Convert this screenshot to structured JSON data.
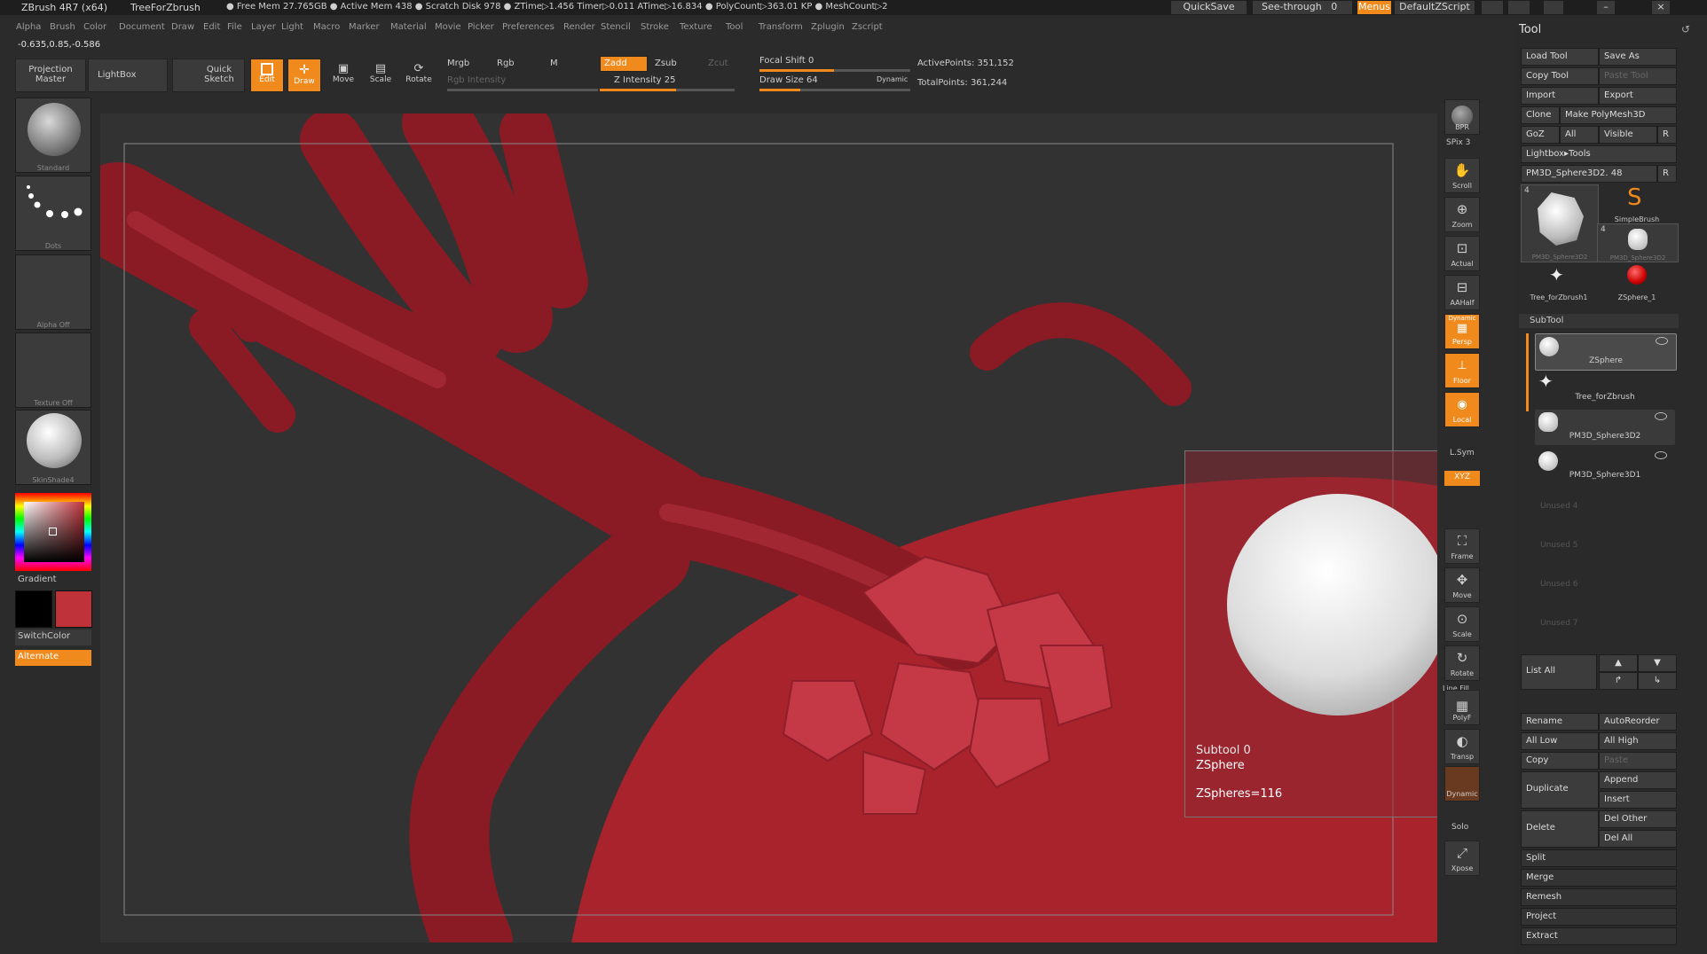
{
  "titlebar": {
    "app": "ZBrush 4R7 (x64)",
    "doc": "TreeForZbrush",
    "stats": "● Free Mem 27.765GB ● Active Mem 438 ● Scratch Disk 978 ● ZTime▷1.456 Timer▷0.011 ATime▷16.834 ● PolyCount▷363.01 KP ● MeshCount▷2",
    "quicksave": "QuickSave",
    "seethrough": "See-through",
    "seethrough_value": "0",
    "menus": "Menus",
    "defaultzscript": "DefaultZScript"
  },
  "menubar": [
    "Alpha",
    "Brush",
    "Color",
    "Document",
    "Draw",
    "Edit",
    "File",
    "Layer",
    "Light",
    "Macro",
    "Marker",
    "Material",
    "Movie",
    "Picker",
    "Preferences",
    "Render",
    "Stencil",
    "Stroke",
    "Texture",
    "Tool",
    "Transform",
    "Zplugin",
    "Zscript"
  ],
  "coords": "-0.635,0.85,-0.586",
  "toolbar": {
    "projection_master": "Projection Master",
    "lightbox": "LightBox",
    "quick_sketch": "Quick Sketch",
    "edit": "Edit",
    "draw": "Draw",
    "move": "Move",
    "scale": "Scale",
    "rotate": "Rotate",
    "mrgb": "Mrgb",
    "rgb": "Rgb",
    "m": "M",
    "rgb_intensity": "Rgb Intensity",
    "zadd": "Zadd",
    "zsub": "Zsub",
    "zcut": "Zcut",
    "z_intensity": "Z Intensity 25",
    "focal_shift": "Focal Shift 0",
    "draw_size": "Draw Size 64",
    "dynamic": "Dynamic",
    "active_points": "ActivePoints: 351,152",
    "total_points": "TotalPoints: 361,244"
  },
  "left_shelf": {
    "standard": "Standard",
    "dots": "Dots",
    "alpha_off": "Alpha Off",
    "texture_off": "Texture Off",
    "skinshade": "SkinShade4",
    "gradient": "Gradient",
    "switchcolor": "SwitchColor",
    "alternate": "Alternate",
    "main_color": "#c0323a",
    "secondary_color": "#000000"
  },
  "viewport": {
    "popup_subtool": "Subtool 0",
    "popup_name": "ZSphere",
    "popup_count": "ZSpheres=116"
  },
  "vtoolbar": {
    "bpr": "BPR",
    "spix": "SPix 3",
    "scroll": "Scroll",
    "zoom": "Zoom",
    "actual": "Actual",
    "aahalf": "AAHalf",
    "dynamic": "Dynamic",
    "persp": "Persp",
    "floor": "Floor",
    "local": "Local",
    "lsym": "L.Sym",
    "xyz": "XYZ",
    "frame": "Frame",
    "move": "Move",
    "scale": "Scale",
    "rotate": "Rotate",
    "line_fill": "Line Fill",
    "polyf": "PolyF",
    "transp": "Transp",
    "dynamic2": "Dynamic",
    "solo": "Solo",
    "xpose": "Xpose"
  },
  "panel": {
    "title": "Tool",
    "load_tool": "Load Tool",
    "save_as": "Save As",
    "copy_tool": "Copy Tool",
    "paste_tool": "Paste Tool",
    "import": "Import",
    "export": "Export",
    "clone": "Clone",
    "make_polymesh": "Make PolyMesh3D",
    "goz": "GoZ",
    "all": "All",
    "visible": "Visible",
    "r": "R",
    "lightbox_tools": "Lightbox▸Tools",
    "current_tool": "PM3D_Sphere3D2. 48",
    "tool_count": "4",
    "tool_thumbs": [
      "PM3D_Sphere3D2",
      "SimpleBrush",
      "PM3D_Sphere3D2",
      "Tree_forZbrush1",
      "ZSphere_1"
    ],
    "subtool_header": "SubTool",
    "subtools": [
      "ZSphere",
      "Tree_forZbrush",
      "PM3D_Sphere3D2",
      "PM3D_Sphere3D1"
    ],
    "unused": [
      "Unused 4",
      "Unused 5",
      "Unused 6",
      "Unused 7"
    ],
    "list_all": "List All",
    "rename": "Rename",
    "autoreorder": "AutoReorder",
    "all_low": "All Low",
    "all_high": "All High",
    "copy": "Copy",
    "paste": "Paste",
    "duplicate": "Duplicate",
    "append": "Append",
    "insert": "Insert",
    "delete": "Delete",
    "del_other": "Del Other",
    "del_all": "Del All",
    "split": "Split",
    "merge": "Merge",
    "remesh": "Remesh",
    "project": "Project",
    "extract": "Extract"
  }
}
